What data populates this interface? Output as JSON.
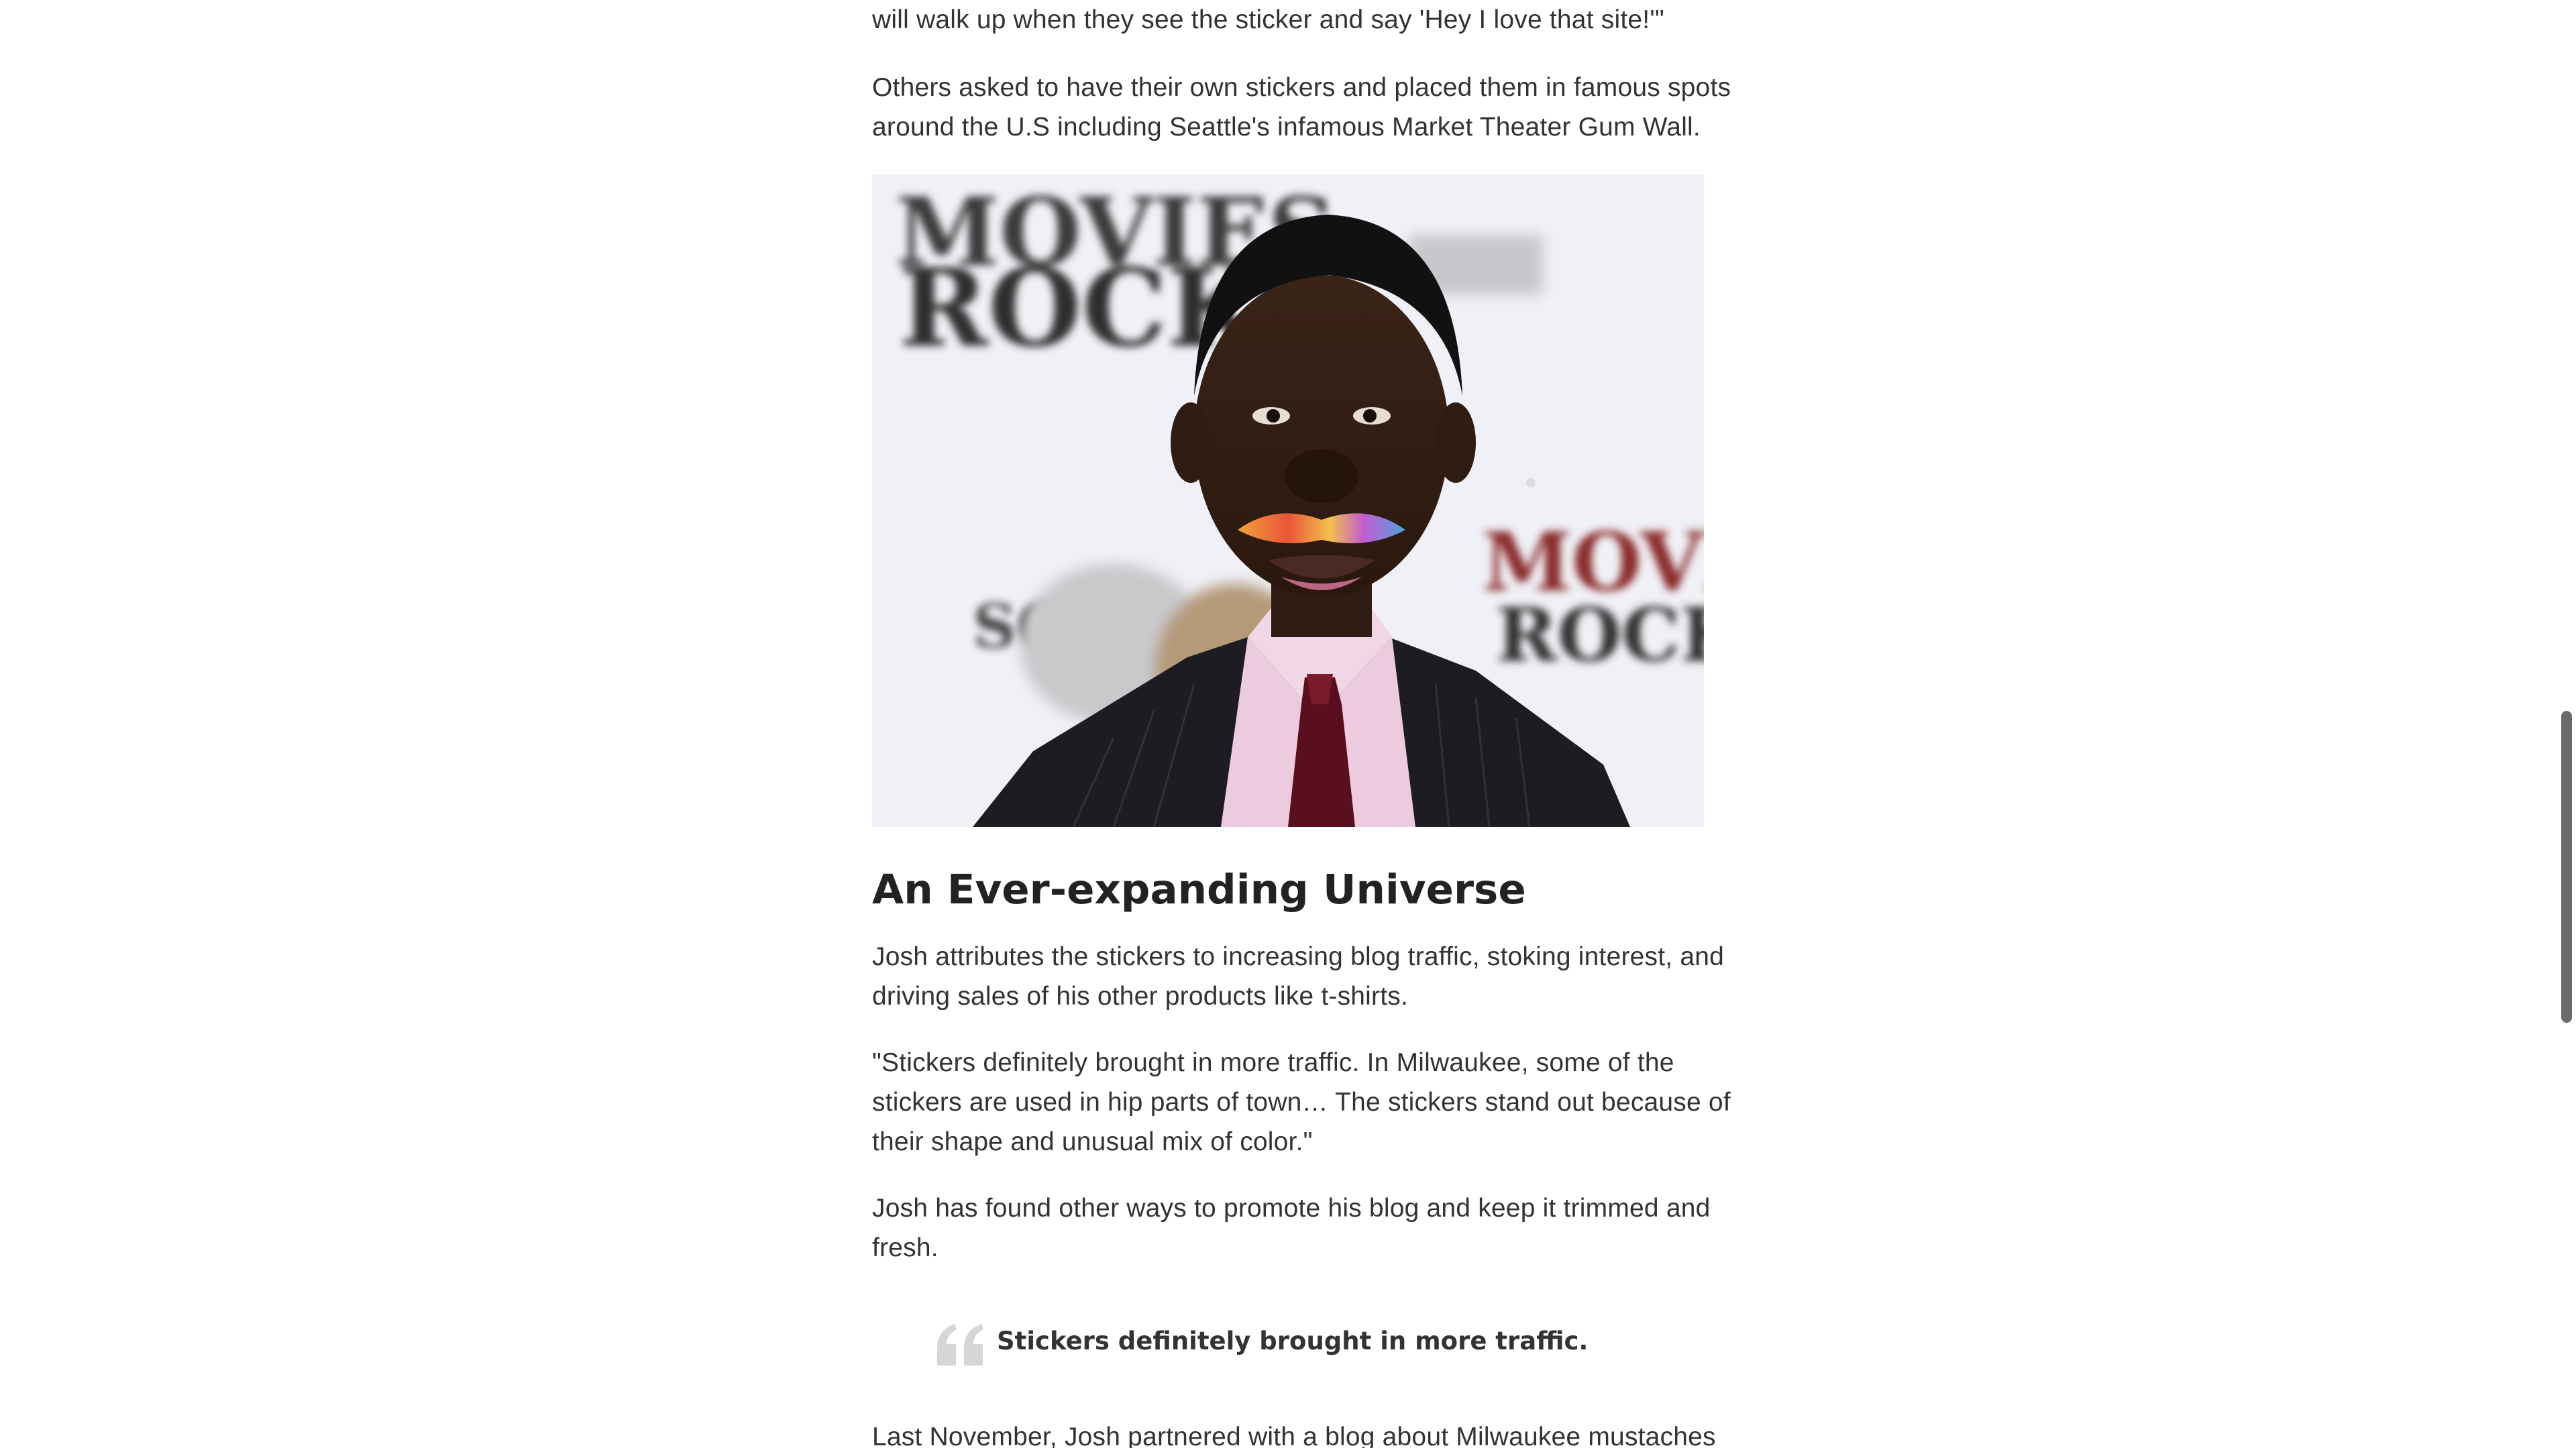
{
  "article": {
    "p_top": {
      "lines": [
        "will walk up when they see the sticker and say 'Hey I love that site!'\""
      ]
    },
    "p_others": {
      "lines": [
        "Others asked to have their own stickers and placed them in famous spots",
        "around the U.S including Seattle's infamous Market Theater Gum Wall."
      ]
    },
    "photo": {
      "backdrop_text_1": "MOVIES",
      "backdrop_text_2": "ROCK",
      "backdrop_text_3": "SONY",
      "backdrop_text_4": "MOVIES",
      "backdrop_text_5": "ROCK"
    },
    "heading": "An Ever-expanding Universe",
    "p_josh_attr": {
      "lines": [
        "Josh attributes the stickers to increasing blog traffic, stoking interest, and",
        "driving sales of his other products like t-shirts."
      ]
    },
    "p_quote": {
      "lines": [
        "\"Stickers definitely brought in more traffic. In Milwaukee, some of the",
        "stickers are used in hip parts of town… The stickers stand out because of",
        "their shape and unusual mix of color.\""
      ]
    },
    "p_josh_found": {
      "lines": [
        "Josh has found other ways to promote his blog and keep it trimmed and",
        "fresh."
      ]
    },
    "pullquote": {
      "text": "Stickers definitely brought in more traffic.",
      "icon": "quote-mark-icon"
    },
    "p_last": {
      "lines": [
        "Last November, Josh partnered with a blog about Milwaukee mustaches"
      ]
    }
  },
  "colors": {
    "text": "#333333",
    "heading": "#222222",
    "quote_mark": "#d6d6d6",
    "scrollbar_thumb": "#6b6b6b"
  }
}
